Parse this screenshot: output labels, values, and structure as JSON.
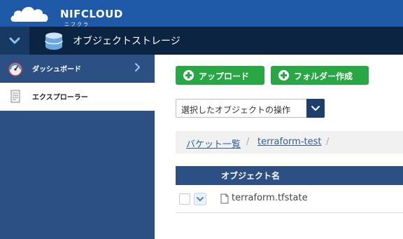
{
  "brand": {
    "name": "NIFCLOUD",
    "subtitle": "ニフクラ"
  },
  "service": {
    "title": "オブジェクトストレージ"
  },
  "sidebar": {
    "items": [
      {
        "label": "ダッシュボード",
        "icon": "gauge-icon"
      },
      {
        "label": "エクスプローラー",
        "icon": "document-icon"
      }
    ]
  },
  "toolbar": {
    "upload_label": "アップロード",
    "new_folder_label": "フォルダー作成"
  },
  "actions_select": {
    "value": "選択したオブジェクトの操作"
  },
  "breadcrumb": {
    "items": [
      "バケット一覧",
      "terraform-test"
    ],
    "separator": "/"
  },
  "table": {
    "columns": [
      "オブジェクト名"
    ],
    "rows": [
      {
        "name": "terraform.tfstate"
      }
    ]
  },
  "colors": {
    "brand_blue": "#1e5aa8",
    "service_bar": "#0a2442",
    "sidebar": "#2d5084",
    "button_green": "#27a844"
  }
}
